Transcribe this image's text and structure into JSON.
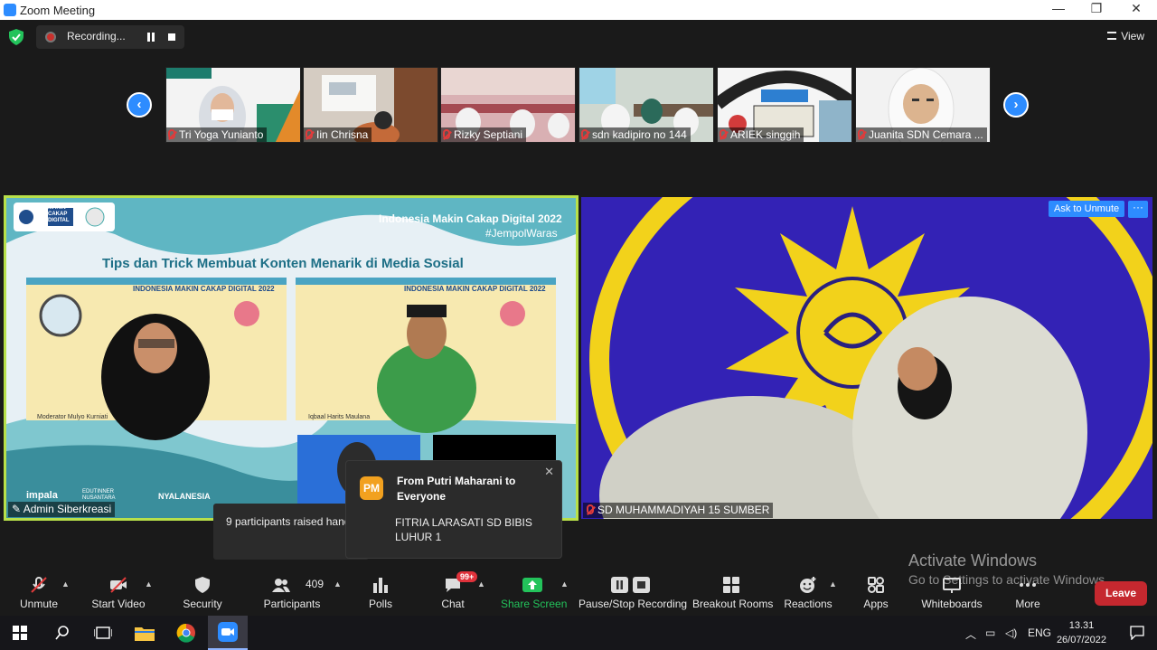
{
  "window": {
    "title": "Zoom Meeting",
    "minimize": "—",
    "maximize": "❐",
    "close": "✕"
  },
  "status": {
    "recording_label": "Recording...",
    "view_label": "View"
  },
  "strip": {
    "prev": "‹",
    "next": "›",
    "thumbnails": [
      {
        "name": "Tri Yoga Yunianto"
      },
      {
        "name": "Iin Chrisna"
      },
      {
        "name": "Rizky Septiani"
      },
      {
        "name": "sdn kadipiro no 144"
      },
      {
        "name": "ARIEK singgih"
      },
      {
        "name": "Juanita SDN Cemara ..."
      }
    ]
  },
  "left_tile": {
    "name": "Admin Siberkreasi",
    "slide_header": "Indonesia Makin Cakap Digital 2022",
    "slide_hashtag": "#JempolWaras",
    "slide_title": "Tips dan Trick Membuat Konten Menarik di Media Sosial",
    "panel_header": "INDONESIA MAKIN CAKAP DIGITAL 2022",
    "speaker1": "Moderator Mulyo Kurniati",
    "speaker2": "Iqbaal Harits Maulana",
    "logo_texts": [
      "MAKIN",
      "CAKAP",
      "DIGITAL"
    ],
    "footer_logos": [
      "impala",
      "EDUTINNER NUSANTARA",
      "NYALANESIA"
    ]
  },
  "right_tile": {
    "name": "SD MUHAMMADIYAH 15 SUMBER",
    "ask_unmute": "Ask to Unmute",
    "more": "···"
  },
  "raised_hand_popup": {
    "text": "9 participants raised hand"
  },
  "chat_popup": {
    "initials": "PM",
    "from": "From Putri Maharani to Everyone",
    "message": "FITRIA LARASATI SD BIBIS LUHUR 1",
    "close": "✕"
  },
  "watermark": {
    "line1": "Activate Windows",
    "line2": "Go to Settings to activate Windows."
  },
  "toolbar": {
    "unmute": "Unmute",
    "start_video": "Start Video",
    "security": "Security",
    "participants": "Participants",
    "participant_count": "409",
    "polls": "Polls",
    "chat": "Chat",
    "chat_badge": "99+",
    "share_screen": "Share Screen",
    "pause_stop": "Pause/Stop Recording",
    "breakout": "Breakout Rooms",
    "reactions": "Reactions",
    "apps": "Apps",
    "whiteboards": "Whiteboards",
    "more": "More",
    "leave": "Leave"
  },
  "taskbar": {
    "lang": "ENG",
    "time": "13.31",
    "date": "26/07/2022"
  },
  "colors": {
    "accent": "#2d8cff",
    "leave": "#c5282f",
    "share": "#23c35b",
    "speaker_border": "#b8e04a"
  }
}
